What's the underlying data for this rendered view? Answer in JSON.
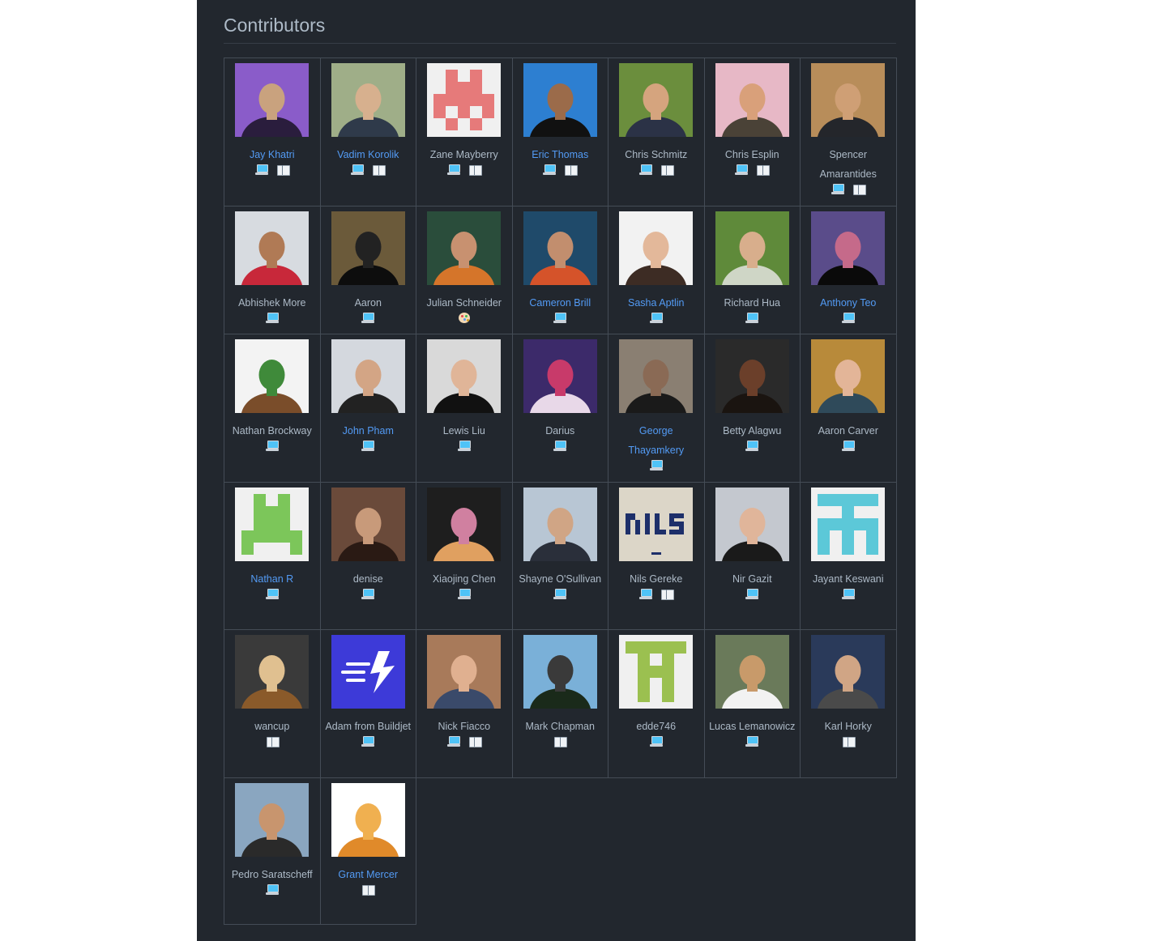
{
  "title": "Contributors",
  "badge_icons": {
    "code": "laptop-icon",
    "doc": "book-icon",
    "design": "palette-icon"
  },
  "colors": {
    "link": "#539bf5",
    "text": "#adbac7",
    "panel": "#22272e",
    "border": "#444c56"
  },
  "contributors": [
    {
      "name": "Jay Khatri",
      "link": true,
      "badges": [
        "code",
        "doc"
      ],
      "avatar": [
        "#8a5cc9",
        "#2a1d3d",
        "#c9a27e"
      ]
    },
    {
      "name": "Vadim Korolik",
      "link": true,
      "badges": [
        "code",
        "doc"
      ],
      "avatar": [
        "#9fae88",
        "#2f3a4a",
        "#d7b08e"
      ]
    },
    {
      "name": "Zane Mayberry",
      "link": false,
      "badges": [
        "code",
        "doc"
      ],
      "avatar": [
        "#f0f0f0",
        "#e67a7a",
        "#e67a7a"
      ],
      "identicon": "x"
    },
    {
      "name": "Eric Thomas",
      "link": true,
      "badges": [
        "code",
        "doc"
      ],
      "avatar": [
        "#2d7fd1",
        "#111111",
        "#9b6b4a"
      ]
    },
    {
      "name": "Chris Schmitz",
      "link": false,
      "badges": [
        "code",
        "doc"
      ],
      "avatar": [
        "#6b8e3d",
        "#2b3246",
        "#d5a47e"
      ]
    },
    {
      "name": "Chris Esplin",
      "link": false,
      "badges": [
        "code",
        "doc"
      ],
      "avatar": [
        "#e7b8c6",
        "#4a4237",
        "#d9a07a"
      ]
    },
    {
      "name": "Spencer Amarantides",
      "link": false,
      "badges": [
        "code",
        "doc"
      ],
      "avatar": [
        "#b88d5a",
        "#24262b",
        "#cf9f75"
      ]
    },
    {
      "name": "Abhishek More",
      "link": false,
      "badges": [
        "code"
      ],
      "avatar": [
        "#d7dbe0",
        "#c8283a",
        "#b07a55"
      ]
    },
    {
      "name": "Aaron",
      "link": false,
      "badges": [
        "code"
      ],
      "avatar": [
        "#6b5a3a",
        "#0d0d0d",
        "#222222"
      ]
    },
    {
      "name": "Julian Schneider",
      "link": false,
      "badges": [
        "design"
      ],
      "avatar": [
        "#2a4d3b",
        "#d5752a",
        "#c89170"
      ]
    },
    {
      "name": "Cameron Brill",
      "link": true,
      "badges": [
        "code"
      ],
      "avatar": [
        "#1f4a6a",
        "#d5532a",
        "#c28e6e"
      ]
    },
    {
      "name": "Sasha Aptlin",
      "link": true,
      "badges": [
        "code"
      ],
      "avatar": [
        "#f2f2f2",
        "#3d2c24",
        "#e3b89a"
      ]
    },
    {
      "name": "Richard Hua",
      "link": false,
      "badges": [
        "code"
      ],
      "avatar": [
        "#5f8a3a",
        "#cfd6c6",
        "#d8ae8c"
      ]
    },
    {
      "name": "Anthony Teo",
      "link": true,
      "badges": [
        "code"
      ],
      "avatar": [
        "#5a4c8a",
        "#0a0a0a",
        "#c56a8a"
      ]
    },
    {
      "name": "Nathan Brockway",
      "link": false,
      "badges": [
        "code"
      ],
      "avatar": [
        "#f3f3f3",
        "#7a4d2a",
        "#3f8a3a"
      ]
    },
    {
      "name": "John Pham",
      "link": true,
      "badges": [
        "code"
      ],
      "avatar": [
        "#d4d8de",
        "#222222",
        "#d3a585"
      ]
    },
    {
      "name": "Lewis Liu",
      "link": false,
      "badges": [
        "code"
      ],
      "avatar": [
        "#d9d9d9",
        "#111111",
        "#e0b598"
      ]
    },
    {
      "name": "Darius",
      "link": false,
      "badges": [
        "code"
      ],
      "avatar": [
        "#3c2a6a",
        "#e8d8e8",
        "#c83a6a"
      ]
    },
    {
      "name": "George Thayamkery",
      "link": true,
      "badges": [
        "code"
      ],
      "avatar": [
        "#8a7f72",
        "#1a1a1a",
        "#8a6a55"
      ]
    },
    {
      "name": "Betty Alagwu",
      "link": false,
      "badges": [
        "code"
      ],
      "avatar": [
        "#2a2a2a",
        "#1a1410",
        "#6b3f2a"
      ]
    },
    {
      "name": "Aaron Carver",
      "link": false,
      "badges": [
        "code"
      ],
      "avatar": [
        "#b88a3a",
        "#2f4a5a",
        "#e3b598"
      ]
    },
    {
      "name": "Nathan R",
      "link": true,
      "badges": [
        "code"
      ],
      "avatar": [
        "#f0f0f0",
        "#7cc65a",
        "#7cc65a"
      ],
      "identicon": "h"
    },
    {
      "name": "denise",
      "link": false,
      "badges": [
        "code"
      ],
      "avatar": [
        "#6a4a3a",
        "#2a1a14",
        "#c89a7a"
      ]
    },
    {
      "name": "Xiaojing Chen",
      "link": false,
      "badges": [
        "code"
      ],
      "avatar": [
        "#1e1e1e",
        "#e0a060",
        "#d080a0"
      ]
    },
    {
      "name": "Shayne O'Sullivan",
      "link": false,
      "badges": [
        "code"
      ],
      "avatar": [
        "#b8c6d4",
        "#2a2f3a",
        "#d0a585"
      ]
    },
    {
      "name": "Nils Gereke",
      "link": false,
      "badges": [
        "code",
        "doc"
      ],
      "avatar": [
        "#dcd6c8",
        "#1d2f6a",
        "#1d2f6a"
      ],
      "logo": "NILS"
    },
    {
      "name": "Nir Gazit",
      "link": false,
      "badges": [
        "code"
      ],
      "avatar": [
        "#c4c8cf",
        "#1a1a1a",
        "#e0b59a"
      ]
    },
    {
      "name": "Jayant Keswani",
      "link": false,
      "badges": [
        "code"
      ],
      "avatar": [
        "#f0f0f0",
        "#5cc8d8",
        "#5cc8d8"
      ],
      "identicon": "t"
    },
    {
      "name": "wancup",
      "link": false,
      "badges": [
        "doc"
      ],
      "avatar": [
        "#3a3a3a",
        "#8a5a2a",
        "#e0c090"
      ]
    },
    {
      "name": "Adam from Buildjet",
      "link": false,
      "badges": [
        "code"
      ],
      "avatar": [
        "#3d3ad8",
        "#ffffff",
        "#ffffff"
      ],
      "logo": "bolt"
    },
    {
      "name": "Nick Fiacco",
      "link": false,
      "badges": [
        "code",
        "doc"
      ],
      "avatar": [
        "#a87a5a",
        "#3a4a6a",
        "#e0b090"
      ]
    },
    {
      "name": "Mark Chapman",
      "link": false,
      "badges": [
        "doc"
      ],
      "avatar": [
        "#7ab0d8",
        "#1a2a1a",
        "#3a3a3a"
      ]
    },
    {
      "name": "edde746",
      "link": false,
      "badges": [
        "code"
      ],
      "avatar": [
        "#f0f0f0",
        "#9bc050",
        "#9bc050"
      ],
      "identicon": "tt"
    },
    {
      "name": "Lucas Lemanowicz",
      "link": false,
      "badges": [
        "code"
      ],
      "avatar": [
        "#6a7a5a",
        "#f2f2f2",
        "#c89a6a"
      ]
    },
    {
      "name": "Karl Horky",
      "link": false,
      "badges": [
        "doc"
      ],
      "avatar": [
        "#2a3a5a",
        "#4a4a4a",
        "#d0a585"
      ]
    },
    {
      "name": "Pedro Saratscheff",
      "link": false,
      "badges": [
        "code"
      ],
      "avatar": [
        "#8aa6c0",
        "#2a2a2a",
        "#c8956e"
      ]
    },
    {
      "name": "Grant Mercer",
      "link": true,
      "badges": [
        "doc"
      ],
      "avatar": [
        "#ffffff",
        "#e08a2a",
        "#f0b050"
      ]
    }
  ]
}
